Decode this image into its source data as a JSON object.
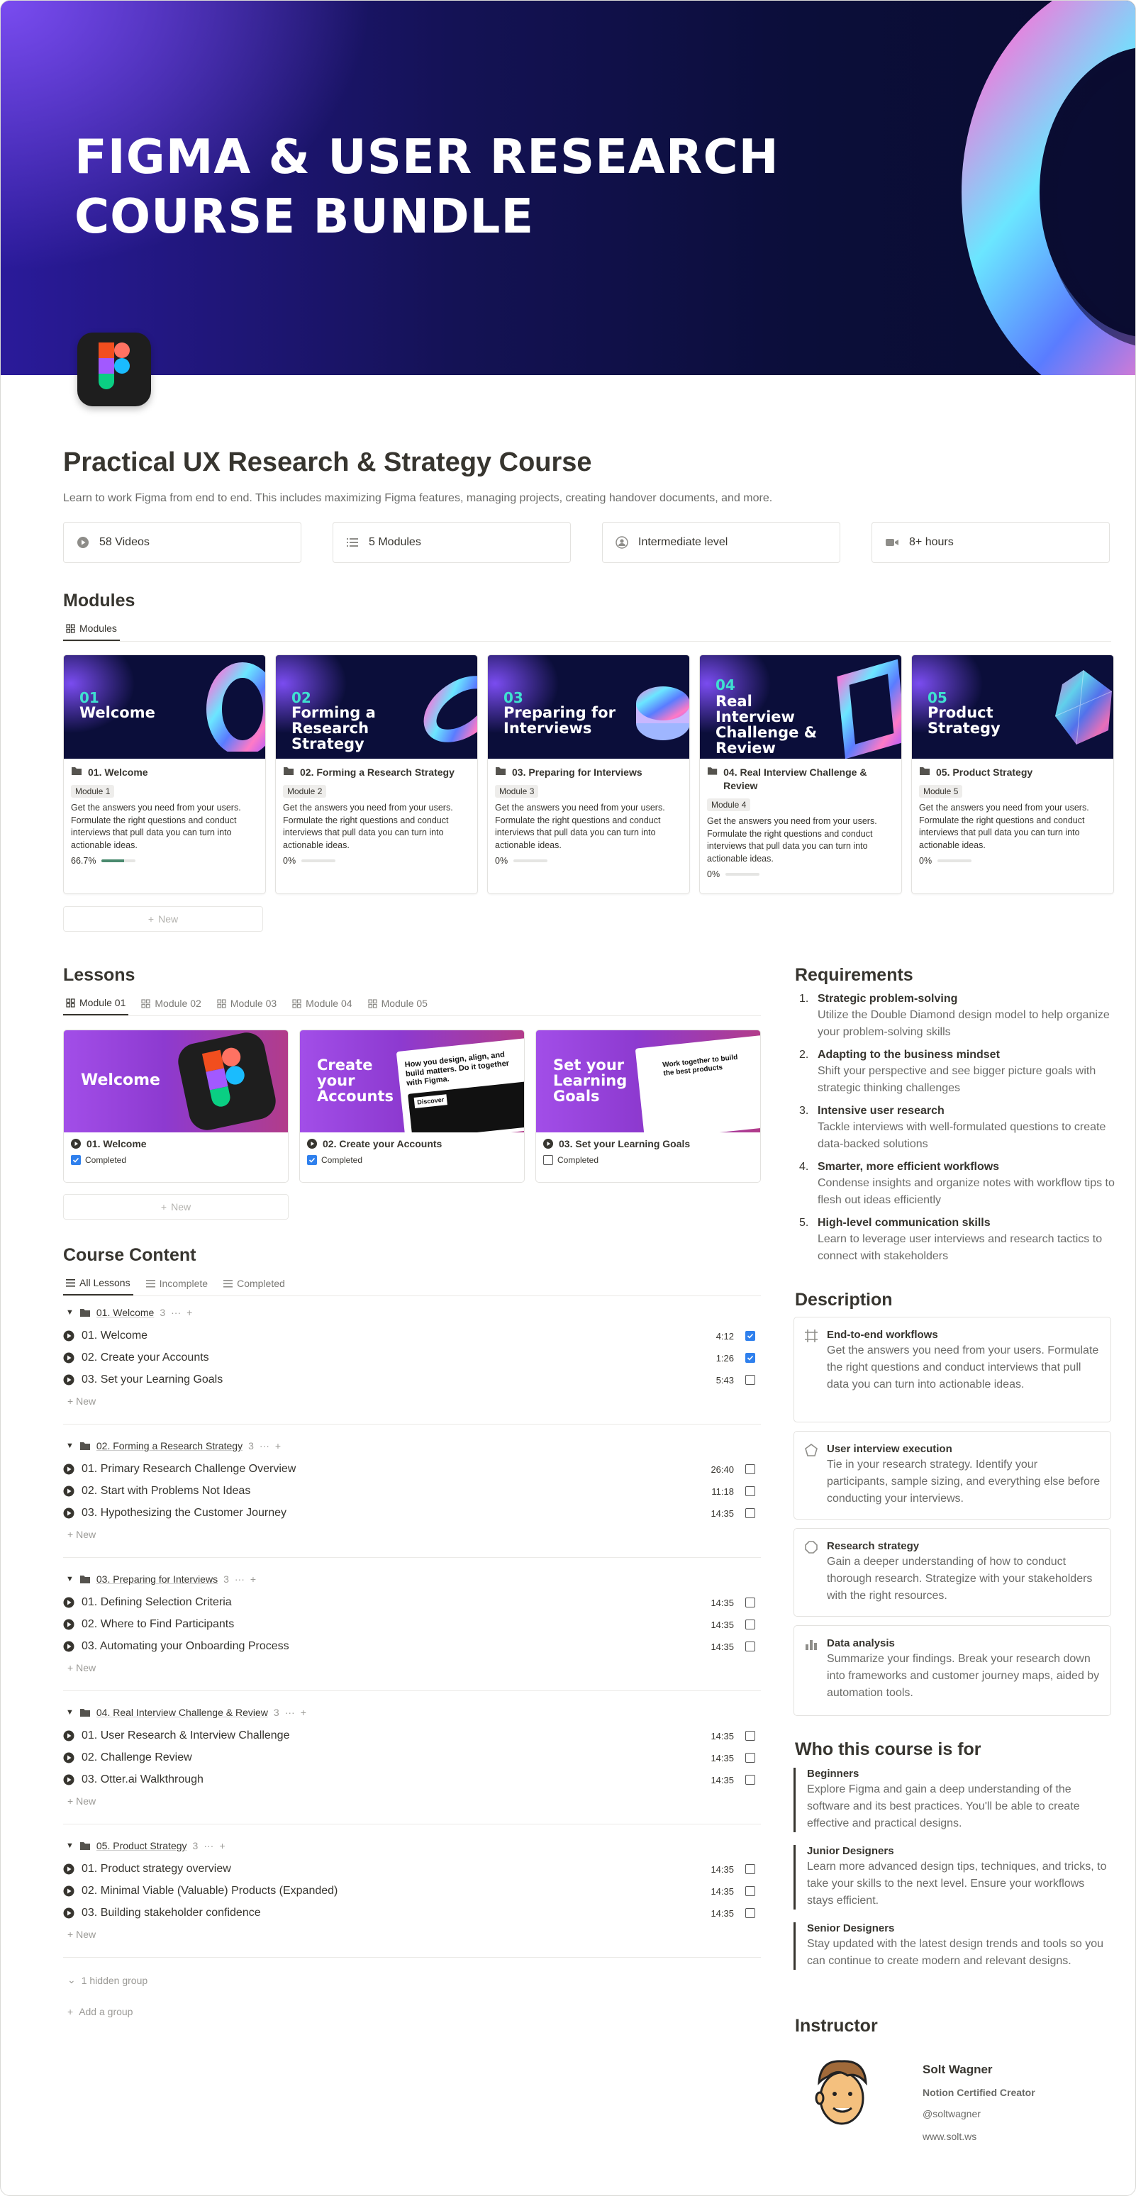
{
  "hero": {
    "title_line1": "FIGMA & USER RESEARCH",
    "title_line2": "COURSE BUNDLE"
  },
  "page": {
    "title": "Practical UX Research & Strategy Course",
    "subtitle": "Learn to work Figma from end to end. This includes maximizing Figma features, managing projects, creating handover documents, and more."
  },
  "stats": [
    {
      "label": "58 Videos",
      "icon": "play-circle-icon"
    },
    {
      "label": "5 Modules",
      "icon": "list-icon"
    },
    {
      "label": "Intermediate level",
      "icon": "user-circle-icon"
    },
    {
      "label": "8+ hours",
      "icon": "video-camera-icon"
    }
  ],
  "modules": {
    "heading": "Modules",
    "tab": "Modules",
    "new_label": "New",
    "cards": [
      {
        "num": "01",
        "cover": "Welcome",
        "name": "01. Welcome",
        "tag": "Module 1",
        "desc": "Get the answers you need from your users. Formulate the right questions and conduct interviews that pull data you can turn into actionable ideas.",
        "progress": "66.7%",
        "progress_value": 0.667
      },
      {
        "num": "02",
        "cover": "Forming a Research Strategy",
        "name": "02. Forming a Research Strategy",
        "tag": "Module 2",
        "desc": "Get the answers you need from your users. Formulate the right questions and conduct interviews that pull data you can turn into actionable ideas.",
        "progress": "0%",
        "progress_value": 0
      },
      {
        "num": "03",
        "cover": "Preparing for Interviews",
        "name": "03. Preparing for Interviews",
        "tag": "Module 3",
        "desc": "Get the answers you need from your users. Formulate the right questions and conduct interviews that pull data you can turn into actionable ideas.",
        "progress": "0%",
        "progress_value": 0
      },
      {
        "num": "04",
        "cover": "Real Interview Challenge & Review",
        "name": "04. Real Interview Challenge & Review",
        "tag": "Module 4",
        "desc": "Get the answers you need from your users. Formulate the right questions and conduct interviews that pull data you can turn into actionable ideas.",
        "progress": "0%",
        "progress_value": 0
      },
      {
        "num": "05",
        "cover": "Product Strategy",
        "name": "05. Product Strategy",
        "tag": "Module 5",
        "desc": "Get the answers you need from your users. Formulate the right questions and conduct interviews that pull data you can turn into actionable ideas.",
        "progress": "0%",
        "progress_value": 0
      }
    ]
  },
  "lessons": {
    "heading": "Lessons",
    "tabs": [
      "Module 01",
      "Module 02",
      "Module 03",
      "Module 04",
      "Module 05"
    ],
    "new_label": "New",
    "cards": [
      {
        "cover": "Welcome",
        "name": "01. Welcome",
        "status": "Completed",
        "done": true
      },
      {
        "cover": "Create your Accounts",
        "name": "02. Create your Accounts",
        "status": "Completed",
        "done": true,
        "shot_text": "How you design, align, and build matters. Do it together with Figma.",
        "shot_label": "Discover"
      },
      {
        "cover": "Set your Learning Goals",
        "name": "03. Set your Learning Goals",
        "status": "Completed",
        "done": false,
        "shot_text": "Work together to build the best products"
      }
    ]
  },
  "content": {
    "heading": "Course Content",
    "tabs": [
      "All Lessons",
      "Incomplete",
      "Completed"
    ],
    "new_label": "New",
    "hidden_group": "1 hidden group",
    "add_group": "Add a group",
    "groups": [
      {
        "name": "01. Welcome",
        "count": "3",
        "rows": [
          {
            "title": "01. Welcome",
            "dur": "4:12",
            "done": true
          },
          {
            "title": "02. Create your Accounts",
            "dur": "1:26",
            "done": true
          },
          {
            "title": "03. Set your Learning Goals",
            "dur": "5:43",
            "done": false
          }
        ]
      },
      {
        "name": "02. Forming a Research Strategy",
        "count": "3",
        "rows": [
          {
            "title": "01. Primary Research Challenge Overview",
            "dur": "26:40",
            "done": false
          },
          {
            "title": "02. Start with Problems Not Ideas",
            "dur": "11:18",
            "done": false
          },
          {
            "title": "03. Hypothesizing the Customer Journey",
            "dur": "14:35",
            "done": false
          }
        ]
      },
      {
        "name": "03. Preparing for Interviews",
        "count": "3",
        "rows": [
          {
            "title": "01. Defining Selection Criteria",
            "dur": "14:35",
            "done": false
          },
          {
            "title": "02. Where to Find Participants",
            "dur": "14:35",
            "done": false
          },
          {
            "title": "03. Automating your Onboarding Process",
            "dur": "14:35",
            "done": false
          }
        ]
      },
      {
        "name": "04. Real Interview Challenge & Review",
        "count": "3",
        "rows": [
          {
            "title": "01. User Research & Interview Challenge",
            "dur": "14:35",
            "done": false
          },
          {
            "title": "02. Challenge Review",
            "dur": "14:35",
            "done": false
          },
          {
            "title": "03. Otter.ai Walkthrough",
            "dur": "14:35",
            "done": false
          }
        ]
      },
      {
        "name": "05. Product Strategy",
        "count": "3",
        "rows": [
          {
            "title": "01. Product strategy overview",
            "dur": "14:35",
            "done": false
          },
          {
            "title": "02. Minimal Viable (Valuable) Products (Expanded)",
            "dur": "14:35",
            "done": false
          },
          {
            "title": "03. Building stakeholder confidence",
            "dur": "14:35",
            "done": false
          }
        ]
      }
    ]
  },
  "requirements": {
    "heading": "Requirements",
    "items": [
      {
        "title": "Strategic problem-solving",
        "desc": "Utilize the Double Diamond design model to help organize your problem-solving skills"
      },
      {
        "title": "Adapting to the business mindset",
        "desc": "Shift your perspective and see bigger picture goals with strategic thinking challenges"
      },
      {
        "title": "Intensive user research",
        "desc": "Tackle interviews with well-formulated questions to create data-backed solutions"
      },
      {
        "title": "Smarter, more efficient workflows",
        "desc": "Condense insights and organize notes with workflow tips to flesh out ideas efficiently"
      },
      {
        "title": "High-level communication skills",
        "desc": "Learn to leverage user interviews and research tactics to connect with stakeholders"
      }
    ]
  },
  "description": {
    "heading": "Description",
    "items": [
      {
        "title": "End-to-end workflows",
        "desc": "Get the answers you need from your users. Formulate the right questions and conduct interviews that pull data you can turn into actionable ideas.",
        "icon": "frame-icon"
      },
      {
        "title": "User interview execution",
        "desc": "Tie in your research strategy. Identify your participants, sample sizing, and everything else before conducting your interviews.",
        "icon": "pentagon-icon"
      },
      {
        "title": "Research strategy",
        "desc": "Gain a deeper understanding of how to conduct thorough research. Strategize with your stakeholders with the right resources.",
        "icon": "octagon-icon"
      },
      {
        "title": "Data analysis",
        "desc": "Summarize your findings. Break your research down into frameworks and customer journey maps, aided by automation tools.",
        "icon": "bar-chart-icon"
      }
    ]
  },
  "who": {
    "heading": "Who this course is for",
    "items": [
      {
        "title": "Beginners",
        "desc": "Explore Figma and gain a deep understanding of the software and its best practices. You'll be able to create effective and practical designs."
      },
      {
        "title": "Junior Designers",
        "desc": "Learn more advanced design tips, techniques, and tricks, to take your skills to the next level. Ensure your workflows stays efficient."
      },
      {
        "title": "Senior Designers",
        "desc": "Stay updated with the latest design trends and tools so you can continue to create modern and relevant designs."
      }
    ]
  },
  "instructor": {
    "heading": "Instructor",
    "name": "Solt Wagner",
    "role": "Notion Certified Creator",
    "handle": "@soltwagner",
    "site": "www.solt.ws"
  },
  "colors": {
    "accent": "#2f80ed",
    "hero_bg": "#0b0e3a",
    "hero_glow": "#7a4cf0",
    "progress": "#4a8a6e",
    "lesson_cover": "#a24ee8"
  }
}
